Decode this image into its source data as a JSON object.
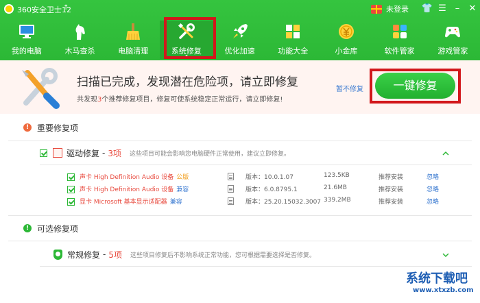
{
  "app": {
    "title": "360安全卫士12",
    "update_arrow": "↑",
    "login": "未登录"
  },
  "window_controls": {
    "skin": "👕",
    "menu": "☰",
    "minimize": "–",
    "close": "✕"
  },
  "nav": [
    {
      "label": "我的电脑",
      "icon": "monitor-icon"
    },
    {
      "label": "木马查杀",
      "icon": "horse-icon"
    },
    {
      "label": "电脑清理",
      "icon": "broom-icon"
    },
    {
      "label": "系统修复",
      "icon": "wrench-icon",
      "active": true
    },
    {
      "label": "优化加速",
      "icon": "rocket-icon"
    },
    {
      "label": "功能大全",
      "icon": "grid-icon"
    },
    {
      "label": "小金库",
      "icon": "coin-icon"
    },
    {
      "label": "软件管家",
      "icon": "apps-icon"
    },
    {
      "label": "游戏管家",
      "icon": "gamepad-icon"
    }
  ],
  "banner": {
    "title": "扫描已完成，发现潜在危险项，请立即修复",
    "sub_before": "共发现",
    "sub_count": "3",
    "sub_after": "个推荐修复项目，修复可使系统稳定正常运行，请立即修复!",
    "pause": "暂不修复",
    "fix_button": "一键修复"
  },
  "important": {
    "title": "重要修复项",
    "icon_text": "!",
    "group": {
      "name": "驱动修复",
      "sep": "-",
      "count": "3项",
      "desc": "这些项目可能会影响您电脑硬件正常使用，建议立即修复。"
    },
    "drivers": [
      {
        "name": "声卡 High Definition Audio 设备",
        "tag": "公版",
        "tag_type": "official",
        "version": "版本：10.0.1.07",
        "size": "123.5KB",
        "action": "推荐安装",
        "ignore": "忽略"
      },
      {
        "name": "声卡 High Definition Audio 设备",
        "tag": "兼容",
        "tag_type": "compat",
        "version": "版本：6.0.8795.1",
        "size": "21.6MB",
        "action": "推荐安装",
        "ignore": "忽略"
      },
      {
        "name": "显卡 Microsoft 基本显示适配器",
        "tag": "兼容",
        "tag_type": "compat",
        "version": "版本：25.20.15032.3007",
        "size": "339.2MB",
        "action": "推荐安装",
        "ignore": "忽略"
      }
    ]
  },
  "optional": {
    "title": "可选修复项",
    "icon_text": "!",
    "group": {
      "name": "常规修复",
      "sep": "-",
      "count": "5项",
      "desc": "这些项目修复后不影响系统正常功能，您可根据需要选择是否修复。"
    }
  },
  "watermark": {
    "top": "系统下载吧",
    "bottom": "www.xtxzb.com"
  },
  "colors": {
    "brand_green": "#2cb836",
    "accent_red": "#e8493d",
    "link_blue": "#3a7ad1",
    "highlight_red": "#d2171b"
  }
}
